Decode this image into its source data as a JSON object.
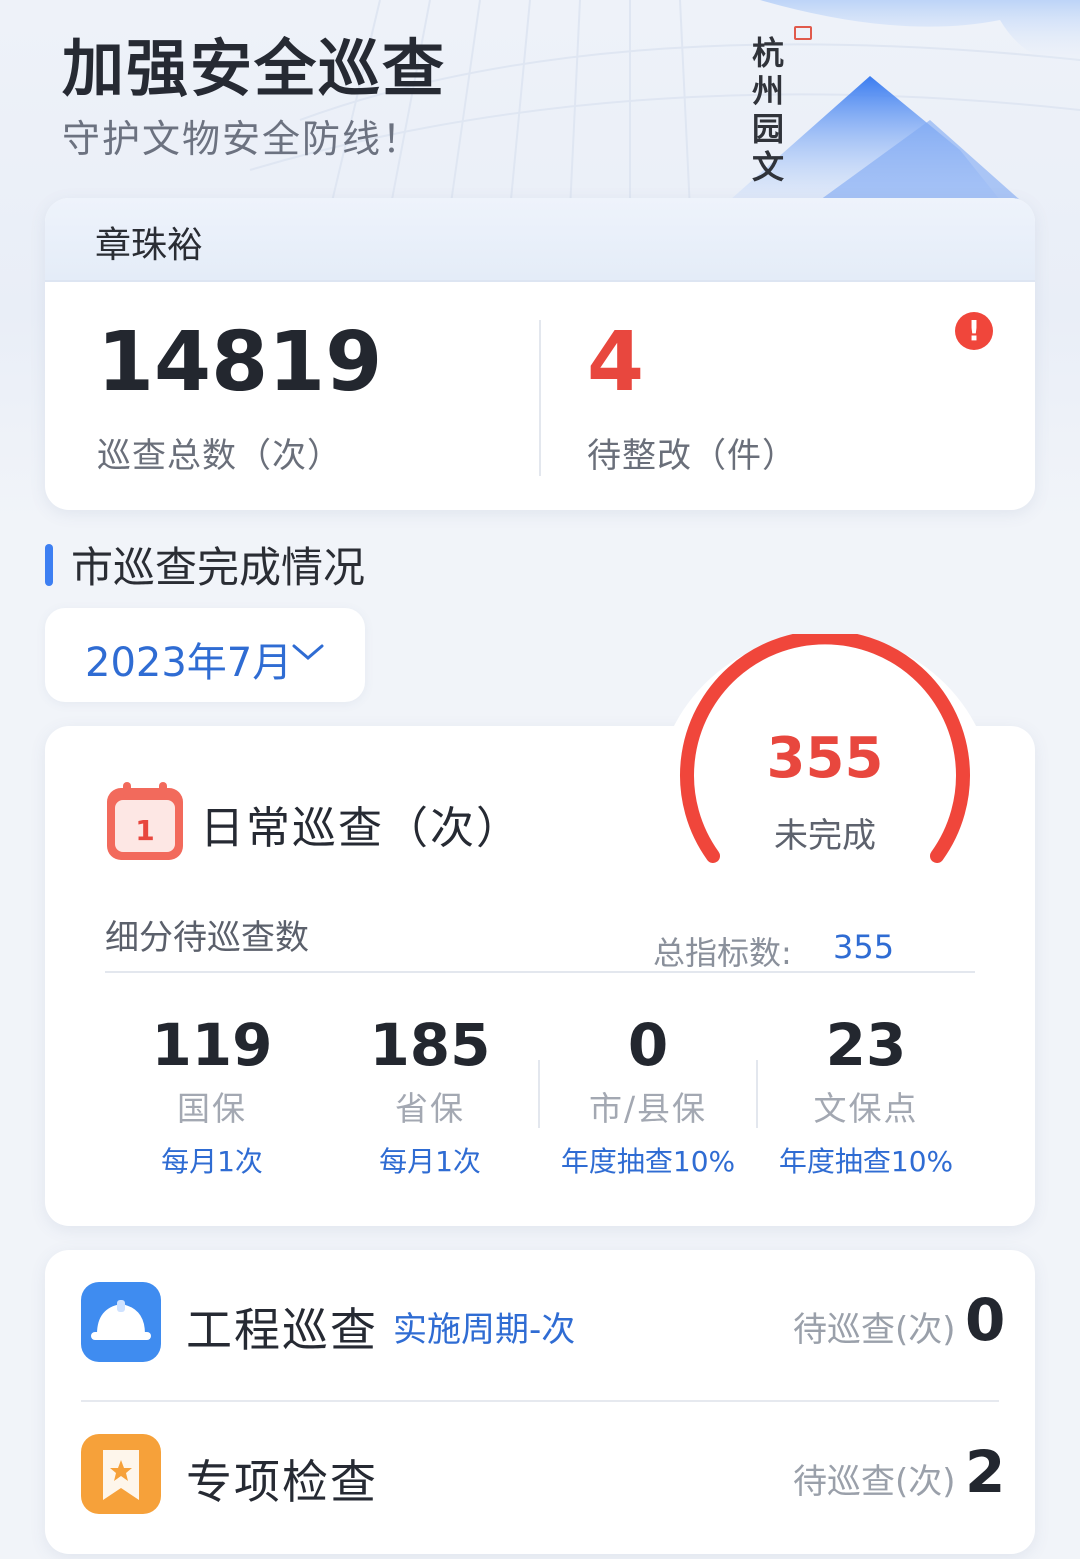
{
  "hero": {
    "title": "加强安全巡查",
    "subtitle": "守护文物安全防线！",
    "calligraphy": "杭州园文"
  },
  "user_card": {
    "name": "章珠裕",
    "total_patrols": {
      "value": "14819",
      "label": "巡查总数（次）"
    },
    "pending_fix": {
      "value": "4",
      "label": "待整改（件）"
    },
    "alert_glyph": "!"
  },
  "section": {
    "title": "市巡查完成情况"
  },
  "date_select": {
    "value": "2023年7月",
    "icon": "chevron-down-icon"
  },
  "daily": {
    "calendar_day": "1",
    "title": "日常巡查（次）",
    "gauge": {
      "value": "355",
      "label": "未完成",
      "progress": 0
    },
    "sub_title": "细分待巡查数",
    "total_label": "总指标数:",
    "total_value": "355",
    "columns": [
      {
        "value": "119",
        "name": "国保",
        "frequency": "每月1次"
      },
      {
        "value": "185",
        "name": "省保",
        "frequency": "每月1次"
      },
      {
        "value": "0",
        "name": "市/县保",
        "frequency": "年度抽查10%"
      },
      {
        "value": "23",
        "name": "文保点",
        "frequency": "年度抽查10%"
      }
    ]
  },
  "list": [
    {
      "title": "工程巡查",
      "tag": "实施周期-次",
      "pending_label": "待巡查(次)",
      "count": "0",
      "icon": "helmet-icon"
    },
    {
      "title": "专项检查",
      "tag": "",
      "pending_label": "待巡查(次)",
      "count": "2",
      "icon": "bookmark-star-icon"
    }
  ],
  "colors": {
    "accent": "#2f6cd3",
    "alert": "#e8473e",
    "helmet_bg": "#3f8cf0",
    "bookmark_bg": "#f6a13a"
  }
}
